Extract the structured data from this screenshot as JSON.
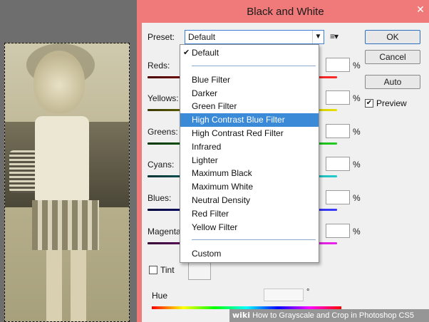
{
  "dialog": {
    "title": "Black and White",
    "close_glyph": "✕",
    "preset_label": "Preset:",
    "preset_value": "Default",
    "buttons": {
      "ok": "OK",
      "cancel": "Cancel",
      "auto": "Auto"
    },
    "preview_label": "Preview",
    "preview_checked": true,
    "sliders": [
      {
        "name": "Reds:",
        "unit": "%",
        "gradient": [
          "#4a0000",
          "#ff2a2a"
        ]
      },
      {
        "name": "Yellows:",
        "unit": "%",
        "gradient": [
          "#3a3a00",
          "#e8e000"
        ]
      },
      {
        "name": "Greens:",
        "unit": "%",
        "gradient": [
          "#003300",
          "#22cc22"
        ]
      },
      {
        "name": "Cyans:",
        "unit": "%",
        "gradient": [
          "#003333",
          "#22cccc"
        ]
      },
      {
        "name": "Blues:",
        "unit": "%",
        "gradient": [
          "#00003a",
          "#3a3aff"
        ]
      },
      {
        "name": "Magentas:",
        "unit": "%",
        "gradient": [
          "#330033",
          "#ee22ee"
        ]
      }
    ],
    "tint_label": "Tint",
    "hue_label": "Hue",
    "hue_unit": "°"
  },
  "preset_menu": {
    "items": [
      {
        "label": "Default",
        "checked": true
      },
      {
        "separator": true
      },
      {
        "label": "Blue Filter"
      },
      {
        "label": "Darker"
      },
      {
        "label": "Green Filter"
      },
      {
        "label": "High Contrast Blue Filter",
        "highlighted": true
      },
      {
        "label": "High Contrast Red Filter"
      },
      {
        "label": "Infrared"
      },
      {
        "label": "Lighter"
      },
      {
        "label": "Maximum Black"
      },
      {
        "label": "Maximum White"
      },
      {
        "label": "Neutral Density"
      },
      {
        "label": "Red Filter"
      },
      {
        "label": "Yellow Filter"
      },
      {
        "separator": true
      },
      {
        "label": "Custom"
      }
    ]
  },
  "watermark": {
    "brand": "wiki",
    "text": "How to Grayscale and Crop in Photoshop CS5"
  },
  "colors": {
    "titlebar": "#f07a7a",
    "highlight": "#3b8ad8"
  }
}
